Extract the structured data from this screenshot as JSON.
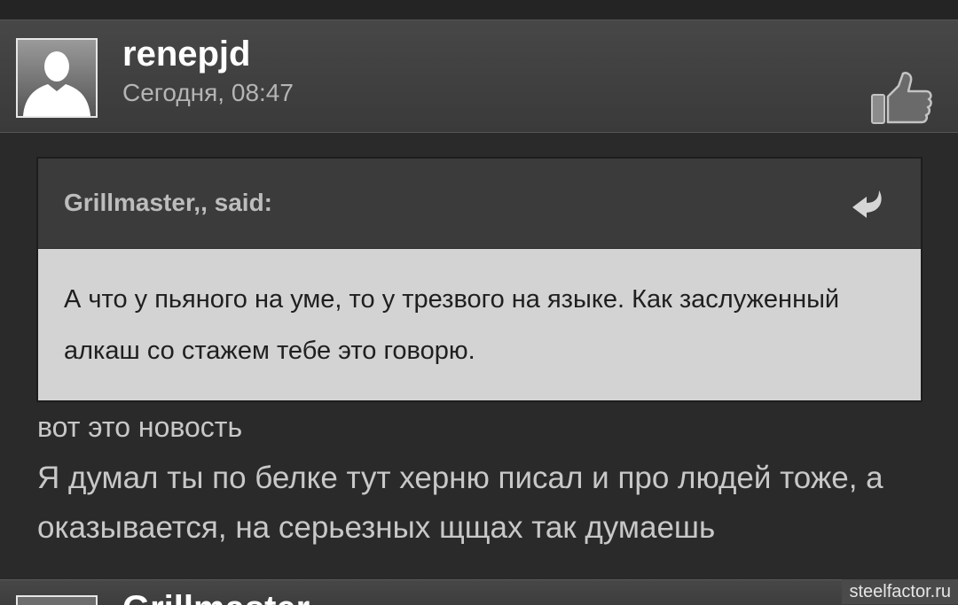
{
  "post": {
    "author": "renepjd",
    "time": "Сегодня, 08:47",
    "avatar_icon": "default-user-silhouette-icon",
    "like_icon": "thumbs-up-icon"
  },
  "quote": {
    "author_label": "Grillmaster,, said:",
    "jump_icon": "jump-to-quote-arrow-icon",
    "text": "А что у пьяного на уме, то у трезвого на языке. Как заслуженный алкаш со стажем тебе это говорю."
  },
  "message": {
    "line1": "вот это новость",
    "line2": "Я думал ты по белке тут херню писал и про людей тоже, а оказывается, на серьезных щщах так думаешь"
  },
  "next_post": {
    "author_partial": "Grillmaster"
  },
  "watermark": "steelfactor.ru",
  "colors": {
    "header_bg": "#474747",
    "body_bg": "#2a2a2a",
    "quote_bg": "#d3d3d3"
  }
}
